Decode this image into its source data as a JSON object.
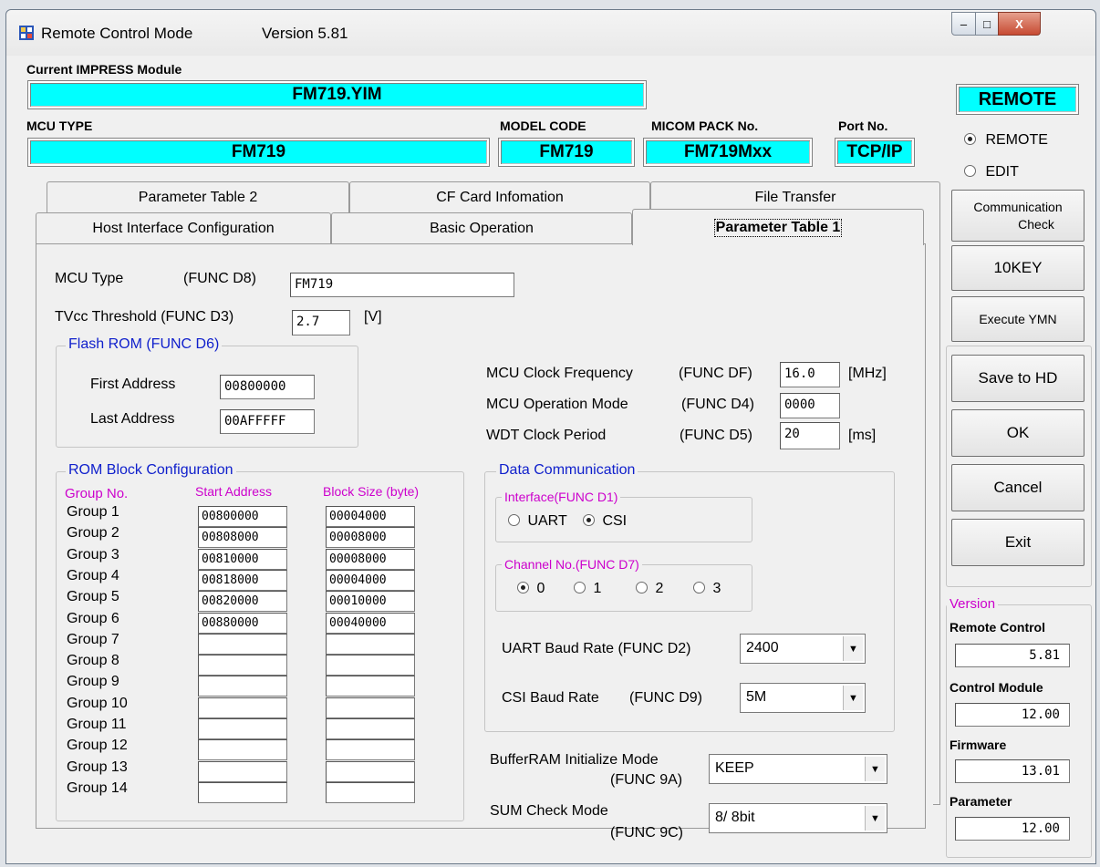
{
  "window": {
    "title": "Remote Control Mode",
    "version_label": "Version  5.81",
    "minimize": "–",
    "maximize": "□",
    "close": "X"
  },
  "header": {
    "module_label": "Current IMPRESS Module",
    "module_value": "FM719.YIM",
    "mcu_type_label": "MCU TYPE",
    "mcu_type_value": "FM719",
    "model_code_label": "MODEL CODE",
    "model_code_value": "FM719",
    "micom_label": "MICOM PACK No.",
    "micom_value": "FM719Mxx",
    "port_label": "Port No.",
    "port_value": "TCP/IP"
  },
  "mode": {
    "badge": "REMOTE",
    "options": [
      "REMOTE",
      "EDIT"
    ],
    "selected": "REMOTE"
  },
  "tabs": {
    "back_row": [
      "Parameter Table 2",
      "CF Card Infomation",
      "File Transfer"
    ],
    "front_row": [
      "Host Interface Configuration",
      "Basic Operation",
      "Parameter Table 1"
    ],
    "active": "Parameter Table 1"
  },
  "params": {
    "mcu_type_label": "MCU Type",
    "mcu_type_func": "(FUNC D8)",
    "mcu_type_value": "FM719",
    "tvcc_label": "TVcc Threshold (FUNC D3)",
    "tvcc_value": "2.7",
    "tvcc_unit": "[V]",
    "flash_title": "Flash ROM (FUNC D6)",
    "first_addr_label": "First Address",
    "first_addr_value": "00800000",
    "last_addr_label": "Last Address",
    "last_addr_value": "00AFFFFF",
    "clock_label": "MCU Clock Frequency",
    "clock_func": "(FUNC DF)",
    "clock_value": "16.0",
    "clock_unit": "[MHz]",
    "opmode_label": "MCU Operation Mode",
    "opmode_func": "(FUNC D4)",
    "opmode_value": "0000",
    "wdt_label": "WDT Clock Period",
    "wdt_func": "(FUNC D5)",
    "wdt_value": "20",
    "wdt_unit": "[ms]"
  },
  "rom_blocks": {
    "title": "ROM Block Configuration",
    "col_group": "Group No.",
    "col_start": "Start Address",
    "col_size": "Block Size (byte)",
    "rows": [
      {
        "group": "Group  1",
        "start": "00800000",
        "size": "00004000"
      },
      {
        "group": "Group  2",
        "start": "00808000",
        "size": "00008000"
      },
      {
        "group": "Group  3",
        "start": "00810000",
        "size": "00008000"
      },
      {
        "group": "Group  4",
        "start": "00818000",
        "size": "00004000"
      },
      {
        "group": "Group  5",
        "start": "00820000",
        "size": "00010000"
      },
      {
        "group": "Group  6",
        "start": "00880000",
        "size": "00040000"
      },
      {
        "group": "Group  7",
        "start": "",
        "size": ""
      },
      {
        "group": "Group  8",
        "start": "",
        "size": ""
      },
      {
        "group": "Group  9",
        "start": "",
        "size": ""
      },
      {
        "group": "Group 10",
        "start": "",
        "size": ""
      },
      {
        "group": "Group 11",
        "start": "",
        "size": ""
      },
      {
        "group": "Group 12",
        "start": "",
        "size": ""
      },
      {
        "group": "Group 13",
        "start": "",
        "size": ""
      },
      {
        "group": "Group 14",
        "start": "",
        "size": ""
      }
    ]
  },
  "data_comm": {
    "title": "Data Communication",
    "interface_title": "Interface(FUNC D1)",
    "interface_options": [
      "UART",
      "CSI"
    ],
    "interface_selected": "CSI",
    "channel_title": "Channel No.(FUNC D7)",
    "channel_options": [
      "0",
      "1",
      "2",
      "3"
    ],
    "channel_selected": "0",
    "uart_label": "UART Baud Rate (FUNC D2)",
    "uart_value": "2400",
    "csi_label": "CSI Baud Rate",
    "csi_func": "(FUNC D9)",
    "csi_value": "5M"
  },
  "buffer": {
    "label1": "BufferRAM Initialize Mode",
    "label2": "(FUNC 9A)",
    "value": "KEEP"
  },
  "sum": {
    "label1": "SUM Check Mode",
    "label2": "(FUNC 9C)",
    "value": "8/ 8bit"
  },
  "side_buttons": {
    "comm_check_1": "Communication",
    "comm_check_2": "Check",
    "tenkey": "10KEY",
    "execute": "Execute YMN",
    "save": "Save to HD",
    "ok": "OK",
    "cancel": "Cancel",
    "exit": "Exit"
  },
  "versions": {
    "title": "Version",
    "remote_label": "Remote Control",
    "remote_value": "5.81",
    "module_label": "Control Module",
    "module_value": "12.00",
    "firmware_label": "Firmware",
    "firmware_value": "13.01",
    "parameter_label": "Parameter",
    "parameter_value": "12.00"
  }
}
